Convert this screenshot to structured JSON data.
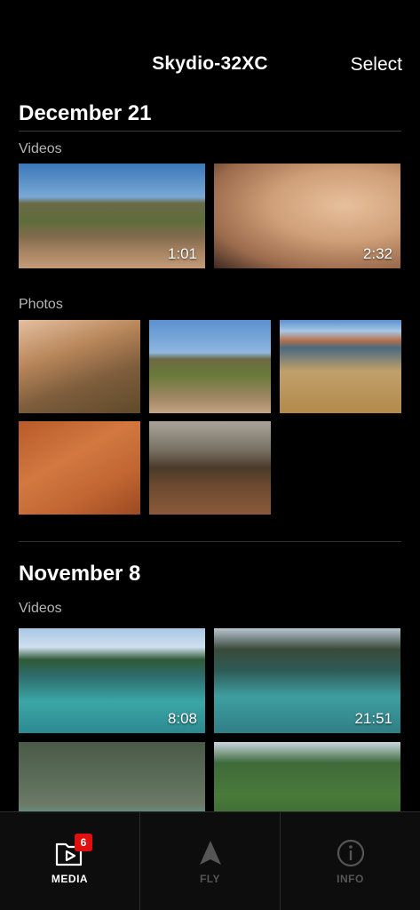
{
  "header": {
    "title": "Skydio-32XC",
    "select_label": "Select"
  },
  "groups": [
    {
      "date": "December 21",
      "videos_label": "Videos",
      "videos": [
        {
          "duration": "1:01"
        },
        {
          "duration": "2:32"
        }
      ],
      "photos_label": "Photos",
      "photo_count": 5
    },
    {
      "date": "November 8",
      "videos_label": "Videos",
      "videos": [
        {
          "duration": "8:08"
        },
        {
          "duration": "21:51"
        },
        {
          "duration": ""
        },
        {
          "duration": ""
        }
      ]
    }
  ],
  "nav": {
    "media_label": "MEDIA",
    "media_badge": "6",
    "fly_label": "FLY",
    "info_label": "INFO"
  },
  "colors": {
    "background": "#000000",
    "badge": "#e01010",
    "inactive": "#555555"
  }
}
